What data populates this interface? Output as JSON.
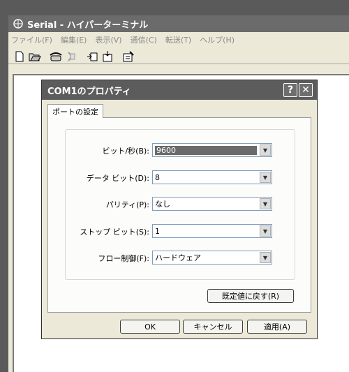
{
  "window": {
    "title": "Serial - ハイパーターミナル"
  },
  "menubar": [
    "ファイル(F)",
    "編集(E)",
    "表示(V)",
    "通信(C)",
    "転送(T)",
    "ヘルプ(H)"
  ],
  "toolbar": [
    "new-file-icon",
    "open-folder-icon",
    "phone-connect-icon",
    "phone-disconnect-icon",
    "send-icon",
    "receive-icon",
    "properties-icon"
  ],
  "dialog": {
    "title": "COM1のプロパティ",
    "help_button": "?",
    "close_button": "✕",
    "tab": "ポートの設定",
    "fields": {
      "bits_per_second": {
        "label": "ビット/秒(B):",
        "value": "9600"
      },
      "data_bits": {
        "label": "データ ビット(D):",
        "value": "8"
      },
      "parity": {
        "label": "パリティ(P):",
        "value": "なし"
      },
      "stop_bits": {
        "label": "ストップ ビット(S):",
        "value": "1"
      },
      "flow_control": {
        "label": "フロー制御(F):",
        "value": "ハードウェア"
      }
    },
    "restore_defaults": "既定値に戻す(R)",
    "ok": "OK",
    "cancel": "キャンセル",
    "apply": "適用(A)"
  }
}
